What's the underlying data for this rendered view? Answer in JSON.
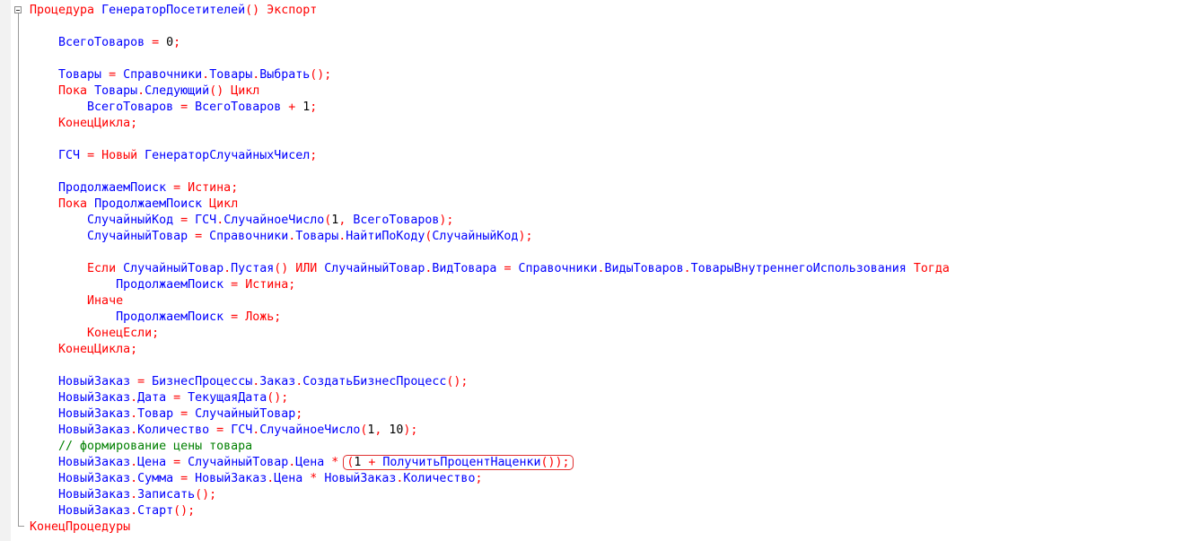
{
  "editor": {
    "lines": [
      [
        {
          "t": "Процедура ",
          "c": "kw"
        },
        {
          "t": "ГенераторПосетителей",
          "c": "id"
        },
        {
          "t": "() ",
          "c": "op"
        },
        {
          "t": "Экспорт",
          "c": "kw"
        }
      ],
      [],
      [
        {
          "t": "    "
        },
        {
          "t": "ВсегоТоваров",
          "c": "id"
        },
        {
          "t": " = ",
          "c": "op"
        },
        {
          "t": "0",
          "c": "num"
        },
        {
          "t": ";",
          "c": "op"
        }
      ],
      [],
      [
        {
          "t": "    "
        },
        {
          "t": "Товары",
          "c": "id"
        },
        {
          "t": " = ",
          "c": "op"
        },
        {
          "t": "Справочники",
          "c": "id"
        },
        {
          "t": ".",
          "c": "op"
        },
        {
          "t": "Товары",
          "c": "id"
        },
        {
          "t": ".",
          "c": "op"
        },
        {
          "t": "Выбрать",
          "c": "id"
        },
        {
          "t": "();",
          "c": "op"
        }
      ],
      [
        {
          "t": "    "
        },
        {
          "t": "Пока ",
          "c": "kw"
        },
        {
          "t": "Товары",
          "c": "id"
        },
        {
          "t": ".",
          "c": "op"
        },
        {
          "t": "Следующий",
          "c": "id"
        },
        {
          "t": "() ",
          "c": "op"
        },
        {
          "t": "Цикл",
          "c": "kw"
        }
      ],
      [
        {
          "t": "        "
        },
        {
          "t": "ВсегоТоваров",
          "c": "id"
        },
        {
          "t": " = ",
          "c": "op"
        },
        {
          "t": "ВсегоТоваров",
          "c": "id"
        },
        {
          "t": " + ",
          "c": "op"
        },
        {
          "t": "1",
          "c": "num"
        },
        {
          "t": ";",
          "c": "op"
        }
      ],
      [
        {
          "t": "    "
        },
        {
          "t": "КонецЦикла",
          "c": "kw"
        },
        {
          "t": ";",
          "c": "op"
        }
      ],
      [],
      [
        {
          "t": "    "
        },
        {
          "t": "ГСЧ",
          "c": "id"
        },
        {
          "t": " = ",
          "c": "op"
        },
        {
          "t": "Новый ",
          "c": "kw"
        },
        {
          "t": "ГенераторСлучайныхЧисел",
          "c": "id"
        },
        {
          "t": ";",
          "c": "op"
        }
      ],
      [],
      [
        {
          "t": "    "
        },
        {
          "t": "ПродолжаемПоиск",
          "c": "id"
        },
        {
          "t": " = ",
          "c": "op"
        },
        {
          "t": "Истина",
          "c": "kw"
        },
        {
          "t": ";",
          "c": "op"
        }
      ],
      [
        {
          "t": "    "
        },
        {
          "t": "Пока ",
          "c": "kw"
        },
        {
          "t": "ПродолжаемПоиск",
          "c": "id"
        },
        {
          "t": " ",
          "c": "op"
        },
        {
          "t": "Цикл",
          "c": "kw"
        }
      ],
      [
        {
          "t": "        "
        },
        {
          "t": "СлучайныйКод",
          "c": "id"
        },
        {
          "t": " = ",
          "c": "op"
        },
        {
          "t": "ГСЧ",
          "c": "id"
        },
        {
          "t": ".",
          "c": "op"
        },
        {
          "t": "СлучайноеЧисло",
          "c": "id"
        },
        {
          "t": "(",
          "c": "op"
        },
        {
          "t": "1",
          "c": "num"
        },
        {
          "t": ", ",
          "c": "op"
        },
        {
          "t": "ВсегоТоваров",
          "c": "id"
        },
        {
          "t": ");",
          "c": "op"
        }
      ],
      [
        {
          "t": "        "
        },
        {
          "t": "СлучайныйТовар",
          "c": "id"
        },
        {
          "t": " = ",
          "c": "op"
        },
        {
          "t": "Справочники",
          "c": "id"
        },
        {
          "t": ".",
          "c": "op"
        },
        {
          "t": "Товары",
          "c": "id"
        },
        {
          "t": ".",
          "c": "op"
        },
        {
          "t": "НайтиПоКоду",
          "c": "id"
        },
        {
          "t": "(",
          "c": "op"
        },
        {
          "t": "СлучайныйКод",
          "c": "id"
        },
        {
          "t": ");",
          "c": "op"
        }
      ],
      [],
      [
        {
          "t": "        "
        },
        {
          "t": "Если ",
          "c": "kw"
        },
        {
          "t": "СлучайныйТовар",
          "c": "id"
        },
        {
          "t": ".",
          "c": "op"
        },
        {
          "t": "Пустая",
          "c": "id"
        },
        {
          "t": "() ",
          "c": "op"
        },
        {
          "t": "ИЛИ ",
          "c": "kw"
        },
        {
          "t": "СлучайныйТовар",
          "c": "id"
        },
        {
          "t": ".",
          "c": "op"
        },
        {
          "t": "ВидТовара",
          "c": "id"
        },
        {
          "t": " = ",
          "c": "op"
        },
        {
          "t": "Справочники",
          "c": "id"
        },
        {
          "t": ".",
          "c": "op"
        },
        {
          "t": "ВидыТоваров",
          "c": "id"
        },
        {
          "t": ".",
          "c": "op"
        },
        {
          "t": "ТоварыВнутреннегоИспользования",
          "c": "id"
        },
        {
          "t": " ",
          "c": "op"
        },
        {
          "t": "Тогда",
          "c": "kw"
        }
      ],
      [
        {
          "t": "            "
        },
        {
          "t": "ПродолжаемПоиск",
          "c": "id"
        },
        {
          "t": " = ",
          "c": "op"
        },
        {
          "t": "Истина",
          "c": "kw"
        },
        {
          "t": ";",
          "c": "op"
        }
      ],
      [
        {
          "t": "        "
        },
        {
          "t": "Иначе",
          "c": "kw"
        }
      ],
      [
        {
          "t": "            "
        },
        {
          "t": "ПродолжаемПоиск",
          "c": "id"
        },
        {
          "t": " = ",
          "c": "op"
        },
        {
          "t": "Ложь",
          "c": "kw"
        },
        {
          "t": ";",
          "c": "op"
        }
      ],
      [
        {
          "t": "        "
        },
        {
          "t": "КонецЕсли",
          "c": "kw"
        },
        {
          "t": ";",
          "c": "op"
        }
      ],
      [
        {
          "t": "    "
        },
        {
          "t": "КонецЦикла",
          "c": "kw"
        },
        {
          "t": ";",
          "c": "op"
        }
      ],
      [],
      [
        {
          "t": "    "
        },
        {
          "t": "НовыйЗаказ",
          "c": "id"
        },
        {
          "t": " = ",
          "c": "op"
        },
        {
          "t": "БизнесПроцессы",
          "c": "id"
        },
        {
          "t": ".",
          "c": "op"
        },
        {
          "t": "Заказ",
          "c": "id"
        },
        {
          "t": ".",
          "c": "op"
        },
        {
          "t": "СоздатьБизнесПроцесс",
          "c": "id"
        },
        {
          "t": "();",
          "c": "op"
        }
      ],
      [
        {
          "t": "    "
        },
        {
          "t": "НовыйЗаказ",
          "c": "id"
        },
        {
          "t": ".",
          "c": "op"
        },
        {
          "t": "Дата",
          "c": "id"
        },
        {
          "t": " = ",
          "c": "op"
        },
        {
          "t": "ТекущаяДата",
          "c": "id"
        },
        {
          "t": "();",
          "c": "op"
        }
      ],
      [
        {
          "t": "    "
        },
        {
          "t": "НовыйЗаказ",
          "c": "id"
        },
        {
          "t": ".",
          "c": "op"
        },
        {
          "t": "Товар",
          "c": "id"
        },
        {
          "t": " = ",
          "c": "op"
        },
        {
          "t": "СлучайныйТовар",
          "c": "id"
        },
        {
          "t": ";",
          "c": "op"
        }
      ],
      [
        {
          "t": "    "
        },
        {
          "t": "НовыйЗаказ",
          "c": "id"
        },
        {
          "t": ".",
          "c": "op"
        },
        {
          "t": "Количество",
          "c": "id"
        },
        {
          "t": " = ",
          "c": "op"
        },
        {
          "t": "ГСЧ",
          "c": "id"
        },
        {
          "t": ".",
          "c": "op"
        },
        {
          "t": "СлучайноеЧисло",
          "c": "id"
        },
        {
          "t": "(",
          "c": "op"
        },
        {
          "t": "1",
          "c": "num"
        },
        {
          "t": ", ",
          "c": "op"
        },
        {
          "t": "10",
          "c": "num"
        },
        {
          "t": ");",
          "c": "op"
        }
      ],
      [
        {
          "t": "    "
        },
        {
          "t": "// формирование цены товара",
          "c": "cm"
        }
      ],
      [
        {
          "t": "    "
        },
        {
          "t": "НовыйЗаказ",
          "c": "id"
        },
        {
          "t": ".",
          "c": "op"
        },
        {
          "t": "Цена",
          "c": "id"
        },
        {
          "t": " = ",
          "c": "op"
        },
        {
          "t": "СлучайныйТовар",
          "c": "id"
        },
        {
          "t": ".",
          "c": "op"
        },
        {
          "t": "Цена",
          "c": "id"
        },
        {
          "t": " * ",
          "c": "op"
        },
        {
          "hl": [
            {
              "t": "(",
              "c": "op"
            },
            {
              "t": "1",
              "c": "num"
            },
            {
              "t": " + ",
              "c": "op"
            },
            {
              "t": "ПолучитьПроцентНаценки",
              "c": "id"
            },
            {
              "t": "());",
              "c": "op"
            }
          ]
        }
      ],
      [
        {
          "t": "    "
        },
        {
          "t": "НовыйЗаказ",
          "c": "id"
        },
        {
          "t": ".",
          "c": "op"
        },
        {
          "t": "Сумма",
          "c": "id"
        },
        {
          "t": " = ",
          "c": "op"
        },
        {
          "t": "НовыйЗаказ",
          "c": "id"
        },
        {
          "t": ".",
          "c": "op"
        },
        {
          "t": "Цена",
          "c": "id"
        },
        {
          "t": " * ",
          "c": "op"
        },
        {
          "t": "НовыйЗаказ",
          "c": "id"
        },
        {
          "t": ".",
          "c": "op"
        },
        {
          "t": "Количество",
          "c": "id"
        },
        {
          "t": ";",
          "c": "op"
        }
      ],
      [
        {
          "t": "    "
        },
        {
          "t": "НовыйЗаказ",
          "c": "id"
        },
        {
          "t": ".",
          "c": "op"
        },
        {
          "t": "Записать",
          "c": "id"
        },
        {
          "t": "();",
          "c": "op"
        }
      ],
      [
        {
          "t": "    "
        },
        {
          "t": "НовыйЗаказ",
          "c": "id"
        },
        {
          "t": ".",
          "c": "op"
        },
        {
          "t": "Старт",
          "c": "id"
        },
        {
          "t": "();",
          "c": "op"
        }
      ],
      [
        {
          "t": "КонецПроцедуры",
          "c": "kw"
        }
      ]
    ]
  }
}
